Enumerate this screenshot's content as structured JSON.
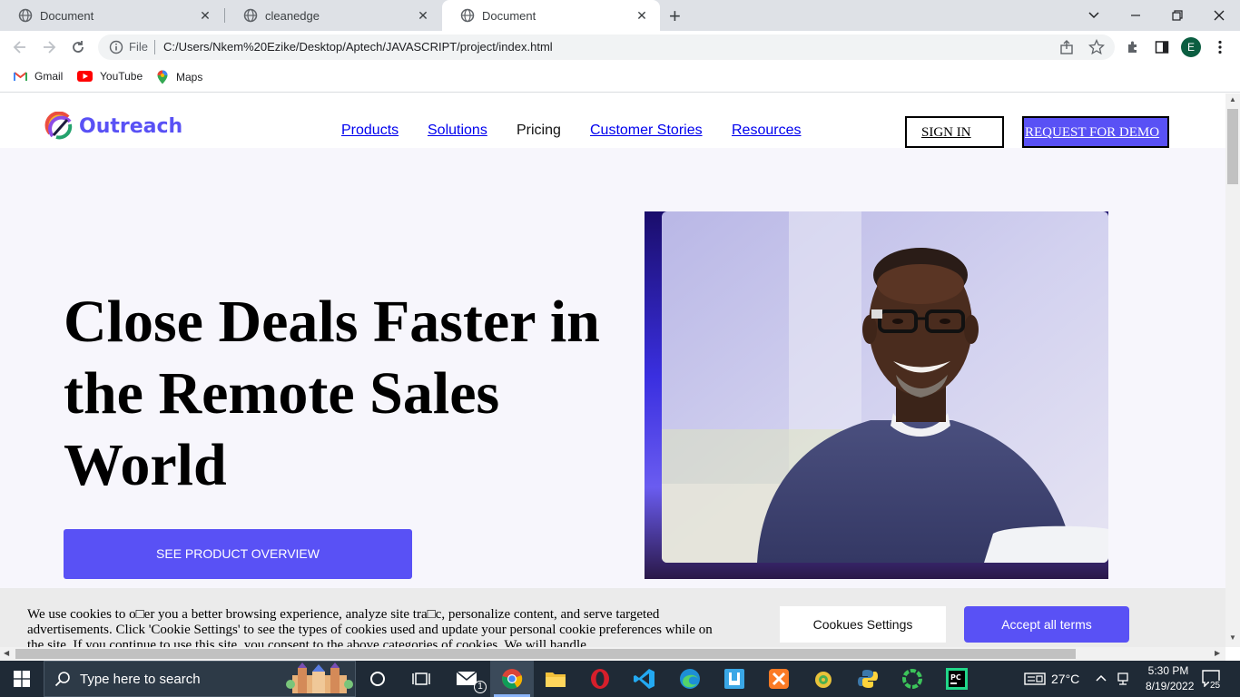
{
  "browser": {
    "tabs": [
      {
        "title": "Document",
        "active": false
      },
      {
        "title": "cleanedge",
        "active": false
      },
      {
        "title": "Document",
        "active": true
      }
    ],
    "new_tab_symbol": "+",
    "omnibox": {
      "scheme_label": "File",
      "url": "C:/Users/Nkem%20Ezike/Desktop/Aptech/JAVASCRIPT/project/index.html"
    },
    "profile_initial": "E",
    "bookmarks": [
      {
        "label": "Gmail",
        "icon": "gmail-icon"
      },
      {
        "label": "YouTube",
        "icon": "youtube-icon"
      },
      {
        "label": "Maps",
        "icon": "maps-icon"
      }
    ]
  },
  "site": {
    "brand": {
      "name": "Outreach",
      "color": "#5951f5"
    },
    "nav": [
      {
        "label": "Products",
        "link": true
      },
      {
        "label": "Solutions",
        "link": true
      },
      {
        "label": "Pricing",
        "link": false
      },
      {
        "label": "Customer Stories",
        "link": true
      },
      {
        "label": "Resources",
        "link": true
      }
    ],
    "sign_in_label": "SIGN IN",
    "demo_label": "REQUEST FOR DEMO",
    "hero": {
      "headline": "Close Deals Faster in the Remote Sales World",
      "cta_label": "SEE PRODUCT OVERVIEW"
    },
    "cookie_banner": {
      "text": "We use cookies to o□er you a better browsing experience, analyze site tra□c, personalize content, and serve targeted advertisements. Click 'Cookie Settings' to see the types of cookies used and update your personal cookie preferences while on the site. If you continue to use this site, you consent to the above categories of cookies. We will handle",
      "settings_label": "Cookues Settings",
      "accept_label": "Accept all terms"
    }
  },
  "taskbar": {
    "search_placeholder": "Type here to search",
    "mail_badge": "1",
    "temperature": "27°C",
    "time": "5:30 PM",
    "date": "8/19/2022",
    "notification_count": "25"
  },
  "colors": {
    "accent": "#5951f5",
    "taskbar": "#1f2a36",
    "page_bg": "#f7f6fc"
  }
}
